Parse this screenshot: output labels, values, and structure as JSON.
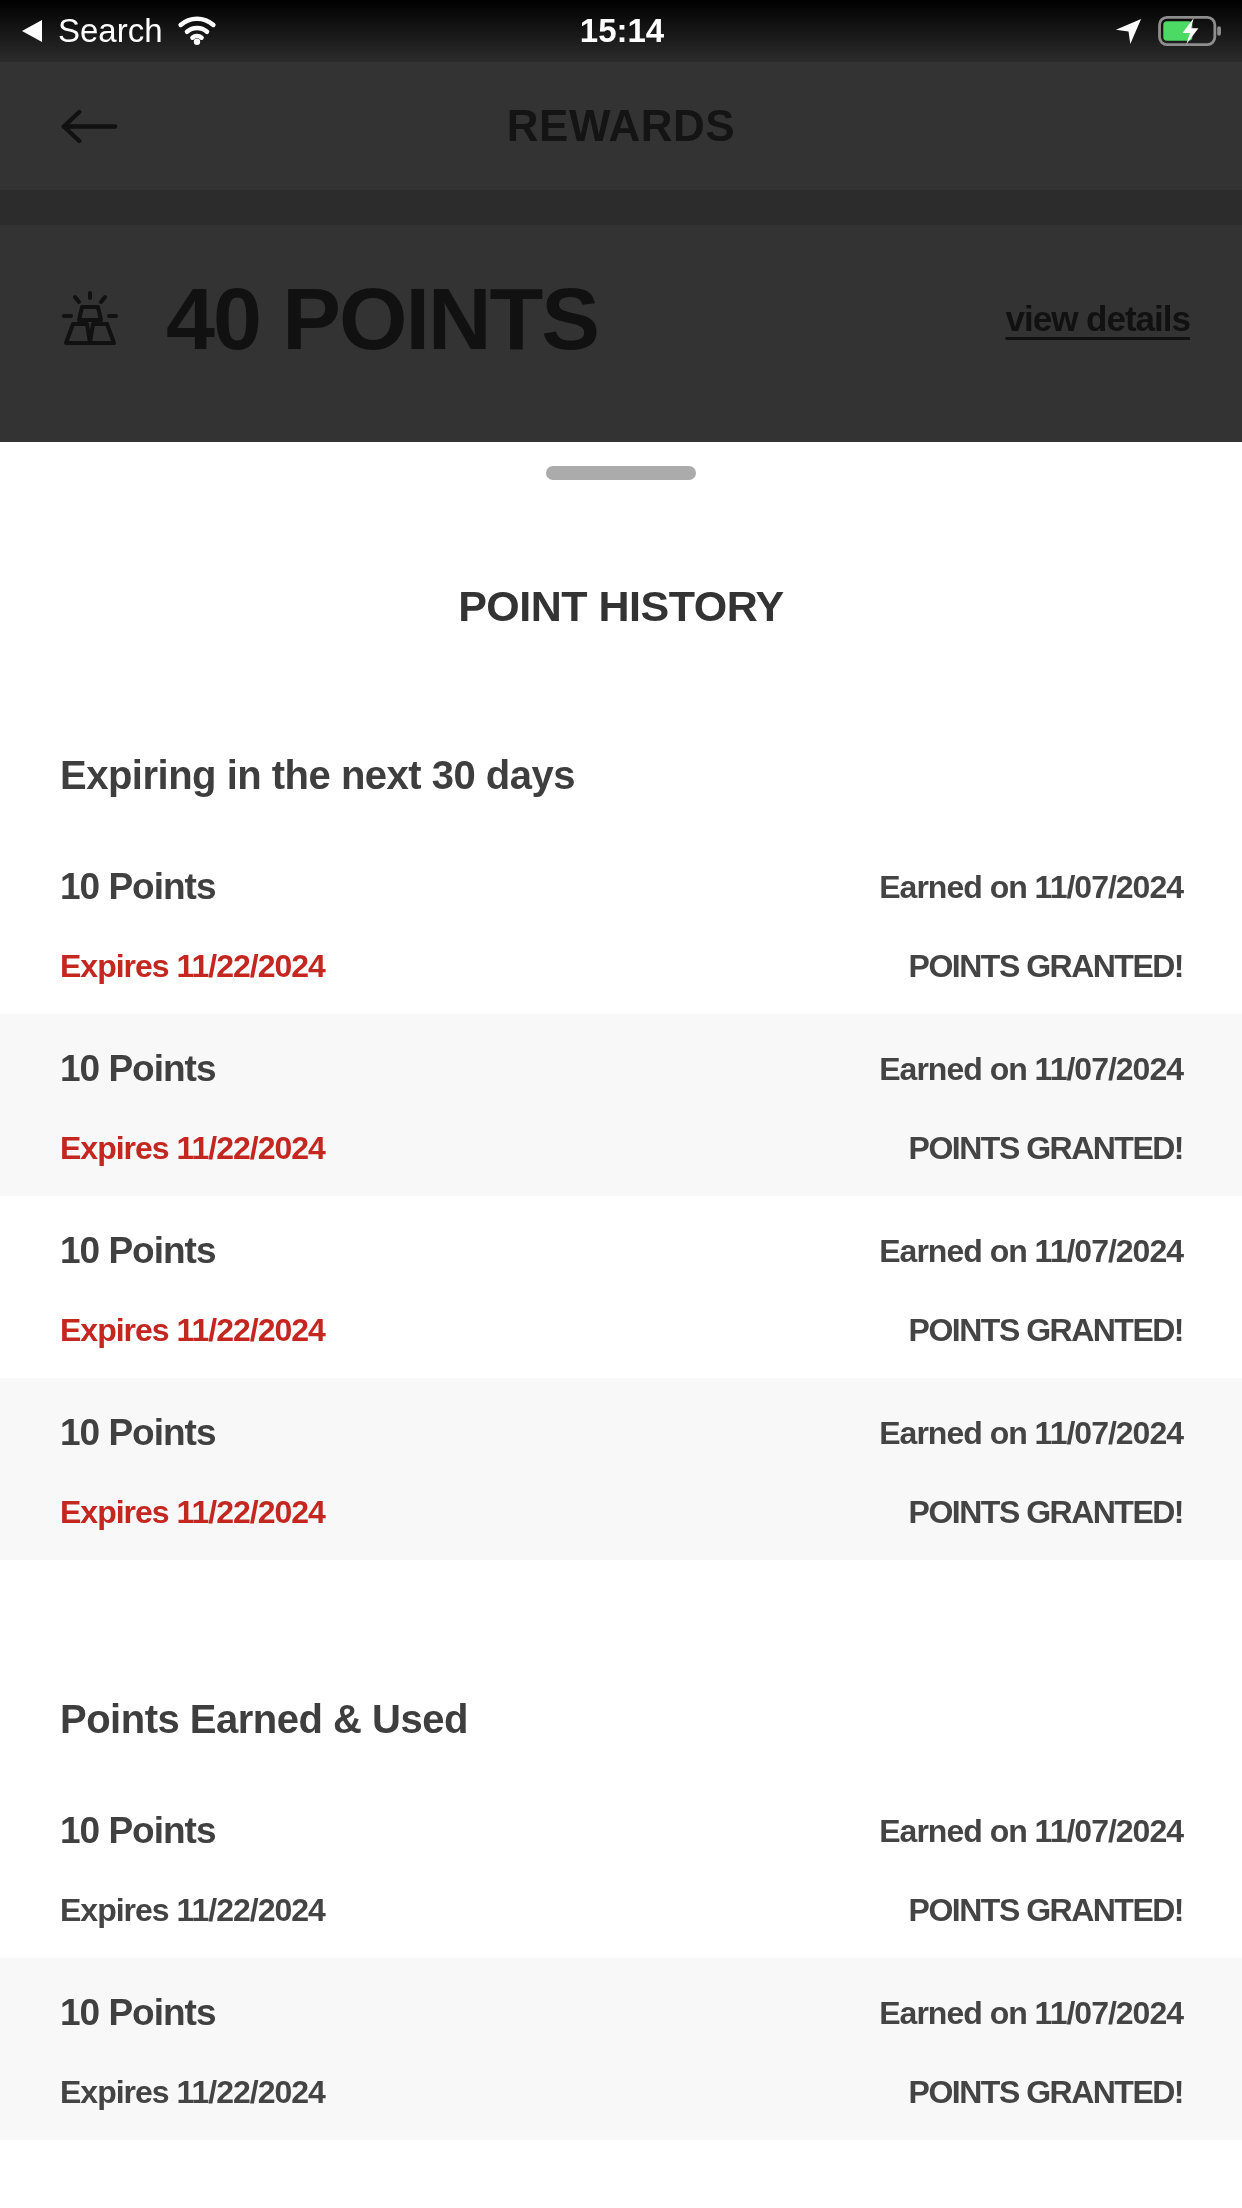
{
  "status_bar": {
    "back_label": "Search",
    "time": "15:14"
  },
  "nav": {
    "title": "REWARDS"
  },
  "points_banner": {
    "points": "40 POINTS",
    "link": "view details"
  },
  "sheet": {
    "title": "POINT HISTORY",
    "sections": [
      {
        "kind": "expiring",
        "title": "Expiring in the next 30 days",
        "rows": [
          {
            "points": "10 Points",
            "earned": "Earned on 11/07/2024",
            "expires": "Expires 11/22/2024",
            "status": "POINTS GRANTED!"
          },
          {
            "points": "10 Points",
            "earned": "Earned on 11/07/2024",
            "expires": "Expires 11/22/2024",
            "status": "POINTS GRANTED!"
          },
          {
            "points": "10 Points",
            "earned": "Earned on 11/07/2024",
            "expires": "Expires 11/22/2024",
            "status": "POINTS GRANTED!"
          },
          {
            "points": "10 Points",
            "earned": "Earned on 11/07/2024",
            "expires": "Expires 11/22/2024",
            "status": "POINTS GRANTED!"
          }
        ]
      },
      {
        "kind": "history",
        "title": "Points Earned & Used",
        "rows": [
          {
            "points": "10 Points",
            "earned": "Earned on 11/07/2024",
            "expires": "Expires 11/22/2024",
            "status": "POINTS GRANTED!"
          },
          {
            "points": "10 Points",
            "earned": "Earned on 11/07/2024",
            "expires": "Expires 11/22/2024",
            "status": "POINTS GRANTED!"
          }
        ]
      }
    ]
  }
}
